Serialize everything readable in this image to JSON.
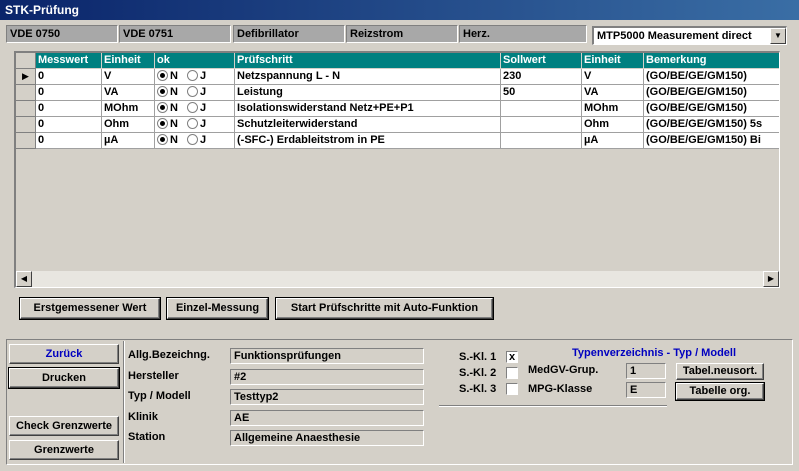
{
  "window": {
    "title": "STK-Prüfung"
  },
  "standards": [
    "VDE 0750",
    "VDE 0751",
    "Defibrillator",
    "Reizstrom",
    "Herz."
  ],
  "measurement_mode": {
    "selected": "MTP5000 Measurement direct"
  },
  "grid": {
    "columns": [
      "Messwert",
      "Einheit",
      "ok",
      "Prüfschritt",
      "Sollwert",
      "Einheit",
      "Bemerkung"
    ],
    "radio_labels": {
      "n": "N",
      "j": "J"
    },
    "rows": [
      {
        "messwert": "0",
        "einheit": "V",
        "ok": "N",
        "pruefschritt": "Netzspannung L - N",
        "sollwert": "230",
        "einheit2": "V",
        "bemerkung": "(GO/BE/GE/GM150)"
      },
      {
        "messwert": "0",
        "einheit": "VA",
        "ok": "N",
        "pruefschritt": "Leistung",
        "sollwert": "50",
        "einheit2": "VA",
        "bemerkung": "(GO/BE/GE/GM150)"
      },
      {
        "messwert": "0",
        "einheit": "MOhm",
        "ok": "N",
        "pruefschritt": "Isolationswiderstand Netz+PE+P1",
        "sollwert": "",
        "einheit2": "MOhm",
        "bemerkung": "(GO/BE/GE/GM150)"
      },
      {
        "messwert": "0",
        "einheit": "Ohm",
        "ok": "N",
        "pruefschritt": "Schutzleiterwiderstand",
        "sollwert": "",
        "einheit2": "Ohm",
        "bemerkung": "(GO/BE/GE/GM150) 5s"
      },
      {
        "messwert": "0",
        "einheit": "µA",
        "ok": "N",
        "pruefschritt": "(-SFC-) Erdableitstrom in PE",
        "sollwert": "",
        "einheit2": "µA",
        "bemerkung": "(GO/BE/GE/GM150) Bi"
      }
    ]
  },
  "actions": {
    "erstgemessener": "Erstgemessener Wert",
    "einzel": "Einzel-Messung",
    "start_auto": "Start Prüfschritte mit Auto-Funktion"
  },
  "side_buttons": {
    "zurueck": "Zurück",
    "drucken": "Drucken",
    "check_grenzwerte": "Check Grenzwerte",
    "grenzwerte": "Grenzwerte"
  },
  "device": {
    "allg_label": "Allg.Bezeichng.",
    "allg_value": "Funktionsprüfungen",
    "hersteller_label": "Hersteller",
    "hersteller_value": "#2",
    "typ_label": "Typ / Modell",
    "typ_value": "Testtyp2",
    "klinik_label": "Klinik",
    "klinik_value": "AE",
    "station_label": "Station",
    "station_value": "Allgemeine Anaesthesie"
  },
  "classes": {
    "skl1_label": "S.-Kl. 1",
    "skl1_checked": true,
    "skl2_label": "S.-Kl. 2",
    "skl2_checked": false,
    "skl3_label": "S.-Kl. 3",
    "skl3_checked": false,
    "check_mark": "x"
  },
  "type_registry": {
    "title": "Typenverzeichnis - Typ / Modell",
    "medgv_label": "MedGV-Grup.",
    "medgv_value": "1",
    "mpg_label": "MPG-Klasse",
    "mpg_value": "E",
    "tabel_neusort": "Tabel.neusort.",
    "tabelle_org": "Tabelle org."
  }
}
